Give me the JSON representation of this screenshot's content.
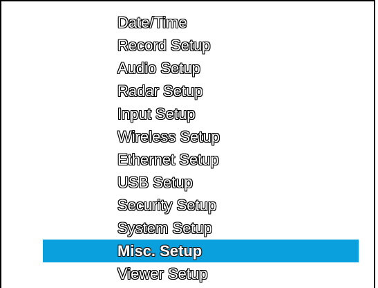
{
  "menu": {
    "items": [
      {
        "label": "Date/Time"
      },
      {
        "label": "Record Setup"
      },
      {
        "label": "Audio Setup"
      },
      {
        "label": "Radar Setup"
      },
      {
        "label": "Input Setup"
      },
      {
        "label": "Wireless Setup"
      },
      {
        "label": "Ethernet Setup"
      },
      {
        "label": "USB Setup"
      },
      {
        "label": "Security Setup"
      },
      {
        "label": "System Setup"
      },
      {
        "label": "Misc. Setup"
      },
      {
        "label": "Viewer Setup"
      }
    ],
    "selected_index": 10,
    "highlight_color": "#0a9fdd"
  }
}
